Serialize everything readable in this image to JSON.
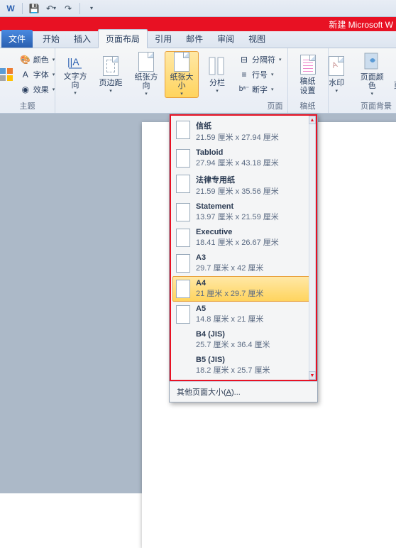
{
  "qat": {
    "items": [
      "save-icon",
      "undo-icon",
      "redo-icon"
    ]
  },
  "titlebar": {
    "title": "新建 Microsoft W"
  },
  "tabs": {
    "file": "文件",
    "items": [
      "开始",
      "插入",
      "页面布局",
      "引用",
      "邮件",
      "审阅",
      "视图"
    ],
    "active_index": 2
  },
  "ribbon": {
    "group_theme": {
      "label": "主题",
      "colors": "颜色",
      "fonts": "字体",
      "effects": "效果"
    },
    "group_pagesetup": {
      "label": "页面",
      "text_direction": "文字方向",
      "margins": "页边距",
      "orientation": "纸张方向",
      "size": "纸张大小",
      "columns": "分栏",
      "breaks": "分隔符",
      "line_numbers": "行号",
      "hyphenation": "断字"
    },
    "group_paper": {
      "label_a": "稿纸",
      "button": "稿纸\n设置"
    },
    "group_bg": {
      "label": "页面背景",
      "watermark": "水印",
      "page_color": "页面颜色",
      "page_border": "页"
    }
  },
  "menu": {
    "items": [
      {
        "title": "信纸",
        "dim": "21.59 厘米 x 27.94 厘米",
        "icon": true
      },
      {
        "title": "Tabloid",
        "dim": "27.94 厘米 x 43.18 厘米",
        "icon": true
      },
      {
        "title": "法律专用纸",
        "dim": "21.59 厘米 x 35.56 厘米",
        "icon": true
      },
      {
        "title": "Statement",
        "dim": "13.97 厘米 x 21.59 厘米",
        "icon": true
      },
      {
        "title": "Executive",
        "dim": "18.41 厘米 x 26.67 厘米",
        "icon": true
      },
      {
        "title": "A3",
        "dim": "29.7 厘米 x 42 厘米",
        "icon": true
      },
      {
        "title": "A4",
        "dim": "21 厘米 x 29.7 厘米",
        "icon": true,
        "selected": true
      },
      {
        "title": "A5",
        "dim": "14.8 厘米 x 21 厘米",
        "icon": true
      },
      {
        "title": "B4 (JIS)",
        "dim": "25.7 厘米 x 36.4 厘米",
        "icon": false
      },
      {
        "title": "B5 (JIS)",
        "dim": "18.2 厘米 x 25.7 厘米",
        "icon": false
      }
    ],
    "footer_prefix": "其他页面大小(",
    "footer_key": "A",
    "footer_suffix": ")..."
  }
}
